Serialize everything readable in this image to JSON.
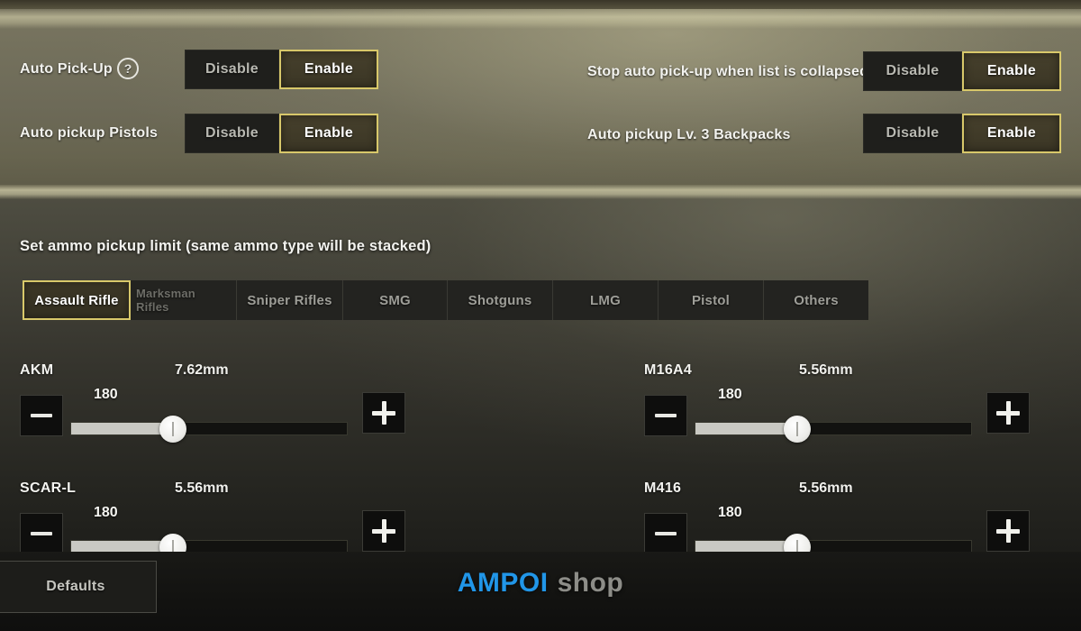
{
  "colors": {
    "accent_gold": "#d8c86a",
    "toggle_on_fill": "#46402c",
    "toggle_off_fill": "#1f1f1c",
    "slider_fill": "#c9c9c3",
    "watermark_blue": "#2196e8",
    "watermark_gray": "#8d8d88"
  },
  "top_panel": {
    "left_rows": [
      {
        "label": "Auto Pick-Up",
        "help_icon": "question-mark-circle-icon",
        "help_glyph": "?",
        "options": [
          "Disable",
          "Enable"
        ],
        "selected": "Enable"
      },
      {
        "label": "Auto pickup Pistols",
        "options": [
          "Disable",
          "Enable"
        ],
        "selected": "Enable"
      }
    ],
    "right_rows": [
      {
        "label": "Stop auto pick-up when list is collapsed",
        "options": [
          "Disable",
          "Enable"
        ],
        "selected": "Enable"
      },
      {
        "label": "Auto pickup Lv. 3 Backpacks",
        "options": [
          "Disable",
          "Enable"
        ],
        "selected": "Enable"
      }
    ]
  },
  "ammo_section": {
    "heading": "Set ammo pickup limit (same ammo type will be stacked)",
    "tabs": [
      {
        "label": "Assault Rifle",
        "active": true,
        "dim": false
      },
      {
        "label": "Marksman Rifles",
        "active": false,
        "dim": true
      },
      {
        "label": "Sniper Rifles",
        "active": false,
        "dim": false
      },
      {
        "label": "SMG",
        "active": false,
        "dim": false
      },
      {
        "label": "Shotguns",
        "active": false,
        "dim": false
      },
      {
        "label": "LMG",
        "active": false,
        "dim": false
      },
      {
        "label": "Pistol",
        "active": false,
        "dim": false
      },
      {
        "label": "Others",
        "active": false,
        "dim": false
      }
    ],
    "decrement_label": "minus-icon",
    "increment_label": "plus-icon",
    "weapons": [
      {
        "name": "AKM",
        "caliber": "7.62mm",
        "value": "180",
        "fill_percent": 37
      },
      {
        "name": "M16A4",
        "caliber": "5.56mm",
        "value": "180",
        "fill_percent": 37
      },
      {
        "name": "SCAR-L",
        "caliber": "5.56mm",
        "value": "180",
        "fill_percent": 37
      },
      {
        "name": "M416",
        "caliber": "5.56mm",
        "value": "180",
        "fill_percent": 37
      }
    ]
  },
  "footer": {
    "defaults_label": "Defaults",
    "watermark_primary": "AMPOI",
    "watermark_secondary": "shop"
  }
}
